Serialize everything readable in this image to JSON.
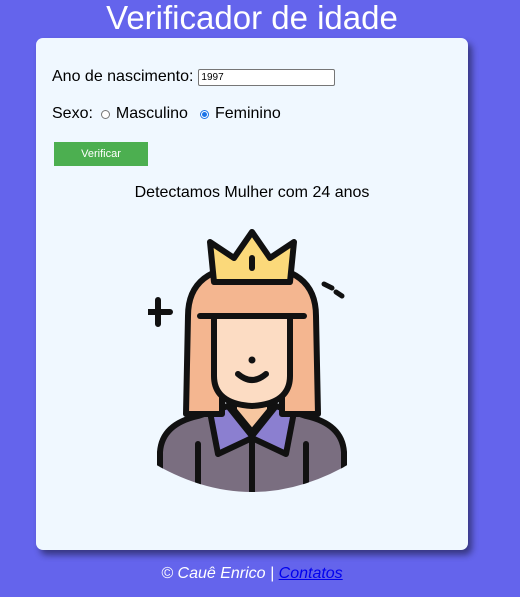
{
  "header": {
    "title": "Verificador de idade"
  },
  "form": {
    "year_label": "Ano de nascimento:",
    "year_value": "1997",
    "sex_label": "Sexo:",
    "options": [
      {
        "label": "Masculino",
        "checked": false
      },
      {
        "label": "Feminino",
        "checked": true
      }
    ],
    "submit_label": "Verificar"
  },
  "result": {
    "text": "Detectamos Mulher com 24 anos"
  },
  "avatar": {
    "icon": "woman-with-crown-avatar"
  },
  "footer": {
    "copyright": "© Cauê Enrico |",
    "link_label": "Contatos"
  },
  "colors": {
    "background": "#6464ec",
    "card": "#f0f8ff",
    "button": "#4caf50"
  }
}
